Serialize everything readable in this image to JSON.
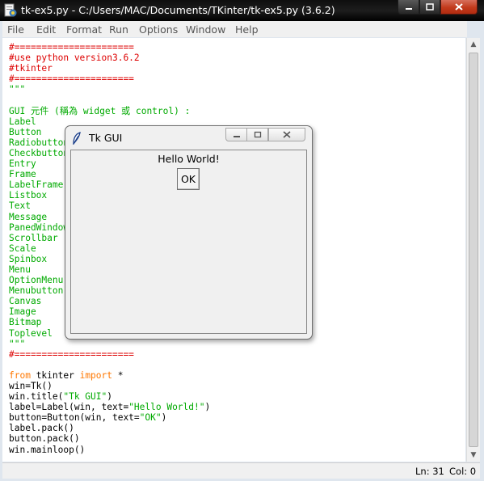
{
  "idle": {
    "title": "tk-ex5.py - C:/Users/MAC/Documents/TKinter/tk-ex5.py (3.6.2)",
    "menu": [
      "File",
      "Edit",
      "Format",
      "Run",
      "Options",
      "Window",
      "Help"
    ],
    "code_lines": [
      {
        "text": "#======================",
        "style": "cm"
      },
      {
        "text": "#use python version3.6.2",
        "style": "cm"
      },
      {
        "text": "#tkinter",
        "style": "cm"
      },
      {
        "text": "#======================",
        "style": "cm"
      },
      {
        "text": "\"\"\"",
        "style": "st"
      },
      {
        "text": "",
        "style": "st"
      },
      {
        "text": "GUI 元件 (稱為 widget 或 control) :",
        "style": "st"
      },
      {
        "text": "Label",
        "style": "st"
      },
      {
        "text": "Button",
        "style": "st"
      },
      {
        "text": "Radiobutton",
        "style": "st"
      },
      {
        "text": "Checkbutton",
        "style": "st"
      },
      {
        "text": "Entry",
        "style": "st"
      },
      {
        "text": "Frame",
        "style": "st"
      },
      {
        "text": "LabelFrame",
        "style": "st"
      },
      {
        "text": "Listbox",
        "style": "st"
      },
      {
        "text": "Text",
        "style": "st"
      },
      {
        "text": "Message",
        "style": "st"
      },
      {
        "text": "PanedWindow",
        "style": "st"
      },
      {
        "text": "Scrollbar",
        "style": "st"
      },
      {
        "text": "Scale",
        "style": "st"
      },
      {
        "text": "Spinbox",
        "style": "st"
      },
      {
        "text": "Menu",
        "style": "st"
      },
      {
        "text": "OptionMenu",
        "style": "st"
      },
      {
        "text": "Menubutton",
        "style": "st"
      },
      {
        "text": "Canvas",
        "style": "st"
      },
      {
        "text": "Image",
        "style": "st"
      },
      {
        "text": "Bitmap",
        "style": "st"
      },
      {
        "text": "Toplevel",
        "style": "st"
      },
      {
        "text": "\"\"\"",
        "style": "st"
      },
      {
        "text": "#======================",
        "style": "cm"
      },
      {
        "text": "",
        "style": ""
      },
      {
        "segments": [
          {
            "text": "from",
            "style": "kw"
          },
          {
            "text": " tkinter ",
            "style": ""
          },
          {
            "text": "import",
            "style": "kw"
          },
          {
            "text": " *",
            "style": ""
          }
        ]
      },
      {
        "text": "win=Tk()",
        "style": ""
      },
      {
        "segments": [
          {
            "text": "win.title(",
            "style": ""
          },
          {
            "text": "\"Tk GUI\"",
            "style": "st"
          },
          {
            "text": ")",
            "style": ""
          }
        ]
      },
      {
        "segments": [
          {
            "text": "label=Label(win, text=",
            "style": ""
          },
          {
            "text": "\"Hello World!\"",
            "style": "st"
          },
          {
            "text": ")",
            "style": ""
          }
        ]
      },
      {
        "segments": [
          {
            "text": "button=Button(win, text=",
            "style": ""
          },
          {
            "text": "\"OK\"",
            "style": "st"
          },
          {
            "text": ")",
            "style": ""
          }
        ]
      },
      {
        "text": "label.pack()",
        "style": ""
      },
      {
        "text": "button.pack()",
        "style": ""
      },
      {
        "text": "win.mainloop()",
        "style": ""
      }
    ],
    "status": {
      "line": "Ln: 31",
      "col": "Col: 0"
    }
  },
  "tk": {
    "title": "Tk GUI",
    "label": "Hello World!",
    "button": "OK"
  },
  "icons": {
    "idle_app": "python-idle-icon",
    "tk_app": "tk-feather-icon",
    "minimize": "minimize-icon",
    "maximize": "maximize-icon",
    "close": "close-icon"
  },
  "colors": {
    "comment": "#dd0000",
    "string": "#00aa00",
    "keyword": "#ff7700",
    "title_bar": "#101010",
    "close_button": "#c23a1c"
  }
}
